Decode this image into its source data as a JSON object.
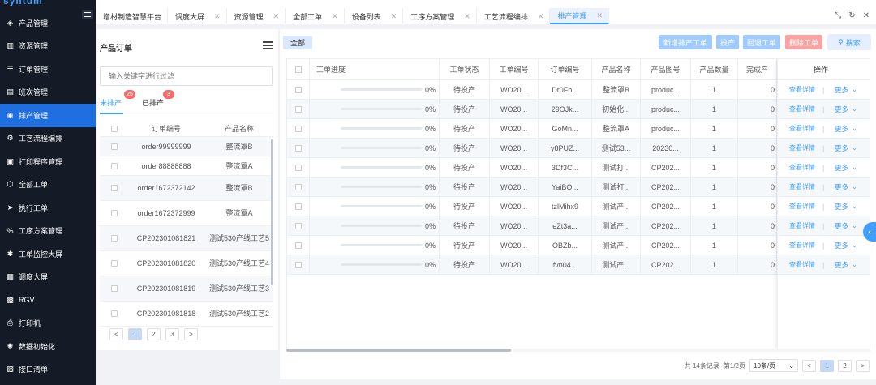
{
  "app": {
    "logo": "syntum"
  },
  "sidebar": {
    "items": [
      {
        "label": "产品管理",
        "icon": "box-icon",
        "glyph": "◈"
      },
      {
        "label": "资源管理",
        "icon": "bar-chart-icon",
        "glyph": "▥"
      },
      {
        "label": "订单管理",
        "icon": "list-icon",
        "glyph": "☰"
      },
      {
        "label": "班次管理",
        "icon": "calendar-icon",
        "glyph": "▤"
      },
      {
        "label": "排产管理",
        "icon": "clock-icon",
        "glyph": "◉"
      },
      {
        "label": "工艺流程编排",
        "icon": "gear-icon",
        "glyph": "⚙"
      },
      {
        "label": "打印程序管理",
        "icon": "printer-icon",
        "glyph": "▣"
      },
      {
        "label": "全部工单",
        "icon": "cube-icon",
        "glyph": "⬡"
      },
      {
        "label": "执行工单",
        "icon": "send-icon",
        "glyph": "➤"
      },
      {
        "label": "工序方案管理",
        "icon": "percent-icon",
        "glyph": "%"
      },
      {
        "label": "工单监控大屏",
        "icon": "monitor-icon",
        "glyph": "✱"
      },
      {
        "label": "调度大屏",
        "icon": "dashboard-icon",
        "glyph": "▦"
      },
      {
        "label": "RGV",
        "icon": "robot-icon",
        "glyph": "▩"
      },
      {
        "label": "打印机",
        "icon": "print-icon",
        "glyph": "⎙"
      },
      {
        "label": "数据初始化",
        "icon": "settings-icon",
        "glyph": "✺"
      },
      {
        "label": "接口清单",
        "icon": "api-icon",
        "glyph": "▧"
      }
    ]
  },
  "tabs": [
    {
      "label": "增材制造智慧平台",
      "closable": false
    },
    {
      "label": "调度大屏",
      "closable": true
    },
    {
      "label": "资源管理",
      "closable": true
    },
    {
      "label": "全部工单",
      "closable": true
    },
    {
      "label": "设备列表",
      "closable": true
    },
    {
      "label": "工序方案管理",
      "closable": true
    },
    {
      "label": "工艺流程编排",
      "closable": true
    },
    {
      "label": "排产管理",
      "closable": true
    }
  ],
  "left": {
    "title": "产品订单",
    "search_placeholder": "输入关键字进行过滤",
    "tab_unscheduled": "未排产",
    "unscheduled_count": "25",
    "tab_scheduled": "已排产",
    "scheduled_count": "3",
    "col_order": "订单编号",
    "col_product": "产品名称",
    "rows": [
      {
        "order": "order99999999",
        "product": "整流罩B",
        "tall": false
      },
      {
        "order": "order88888888",
        "product": "整流罩A",
        "tall": false
      },
      {
        "order": "order1672372142",
        "product": "整流罩B",
        "tall": true
      },
      {
        "order": "order1672372999",
        "product": "整流罩A",
        "tall": true
      },
      {
        "order": "CP202301081821",
        "product": "测试530产线工艺5",
        "tall": true
      },
      {
        "order": "CP202301081820",
        "product": "测试530产线工艺4",
        "tall": true
      },
      {
        "order": "CP202301081819",
        "product": "测试530产线工艺3",
        "tall": true
      },
      {
        "order": "CP202301081818",
        "product": "测试530产线工艺2",
        "tall": true
      }
    ],
    "pager": {
      "prev": "<",
      "pages": [
        "1",
        "2",
        "3"
      ],
      "next": ">"
    }
  },
  "right": {
    "filter_all": "全部",
    "btn_add": "新增排产工单",
    "btn_produce": "投产",
    "btn_rollback": "回退工单",
    "btn_delete": "删除工单",
    "btn_search": "搜索",
    "headers": {
      "progress": "工单进度",
      "status": "工单状态",
      "wo": "工单编号",
      "order": "订单编号",
      "product": "产品名称",
      "drawing": "产品图号",
      "qty": "产品数量",
      "done": "完成产",
      "ops": "操作"
    },
    "rows": [
      {
        "progress": 0,
        "pct": "0%",
        "status": "待投产",
        "wo": "WO20...",
        "order": "Dr0Fb...",
        "product": "整流罩B",
        "drawing": "produc...",
        "qty": "1",
        "done": "0"
      },
      {
        "progress": 0,
        "pct": "0%",
        "status": "待投产",
        "wo": "WO20...",
        "order": "29OJk...",
        "product": "初始化...",
        "drawing": "produc...",
        "qty": "1",
        "done": "0"
      },
      {
        "progress": 0,
        "pct": "0%",
        "status": "待投产",
        "wo": "WO20...",
        "order": "GoMn...",
        "product": "整流罩A",
        "drawing": "produc...",
        "qty": "1",
        "done": "0"
      },
      {
        "progress": 0,
        "pct": "0%",
        "status": "待投产",
        "wo": "WO20...",
        "order": "y8PUZ...",
        "product": "测试53...",
        "drawing": "20230...",
        "qty": "1",
        "done": "0"
      },
      {
        "progress": 0,
        "pct": "0%",
        "status": "待投产",
        "wo": "WO20...",
        "order": "3Df3C...",
        "product": "测试打...",
        "drawing": "CP202...",
        "qty": "1",
        "done": "0"
      },
      {
        "progress": 0,
        "pct": "0%",
        "status": "待投产",
        "wo": "WO20...",
        "order": "YaiBO...",
        "product": "测试打...",
        "drawing": "CP202...",
        "qty": "1",
        "done": "0"
      },
      {
        "progress": 0,
        "pct": "0%",
        "status": "待投产",
        "wo": "WO20...",
        "order": "tzlMihx9",
        "product": "测试产...",
        "drawing": "CP202...",
        "qty": "1",
        "done": "0"
      },
      {
        "progress": 0,
        "pct": "0%",
        "status": "待投产",
        "wo": "WO20...",
        "order": "eZt3a...",
        "product": "测试产...",
        "drawing": "CP202...",
        "qty": "1",
        "done": "0"
      },
      {
        "progress": 0,
        "pct": "0%",
        "status": "待投产",
        "wo": "WO20...",
        "order": "OBZb...",
        "product": "测试产...",
        "drawing": "CP202...",
        "qty": "1",
        "done": "0"
      },
      {
        "progress": 0,
        "pct": "0%",
        "status": "待投产",
        "wo": "WO20...",
        "order": "fvn04...",
        "product": "测试产...",
        "drawing": "CP202...",
        "qty": "1",
        "done": "0"
      }
    ],
    "op_view": "查看详情",
    "op_sep": "|",
    "op_more": "更多",
    "pager": {
      "total": "共 14条记录",
      "page_info": "第1/2页",
      "page_size": "10条/页",
      "prev": "<",
      "pages": [
        "1",
        "2"
      ],
      "next": ">"
    }
  }
}
